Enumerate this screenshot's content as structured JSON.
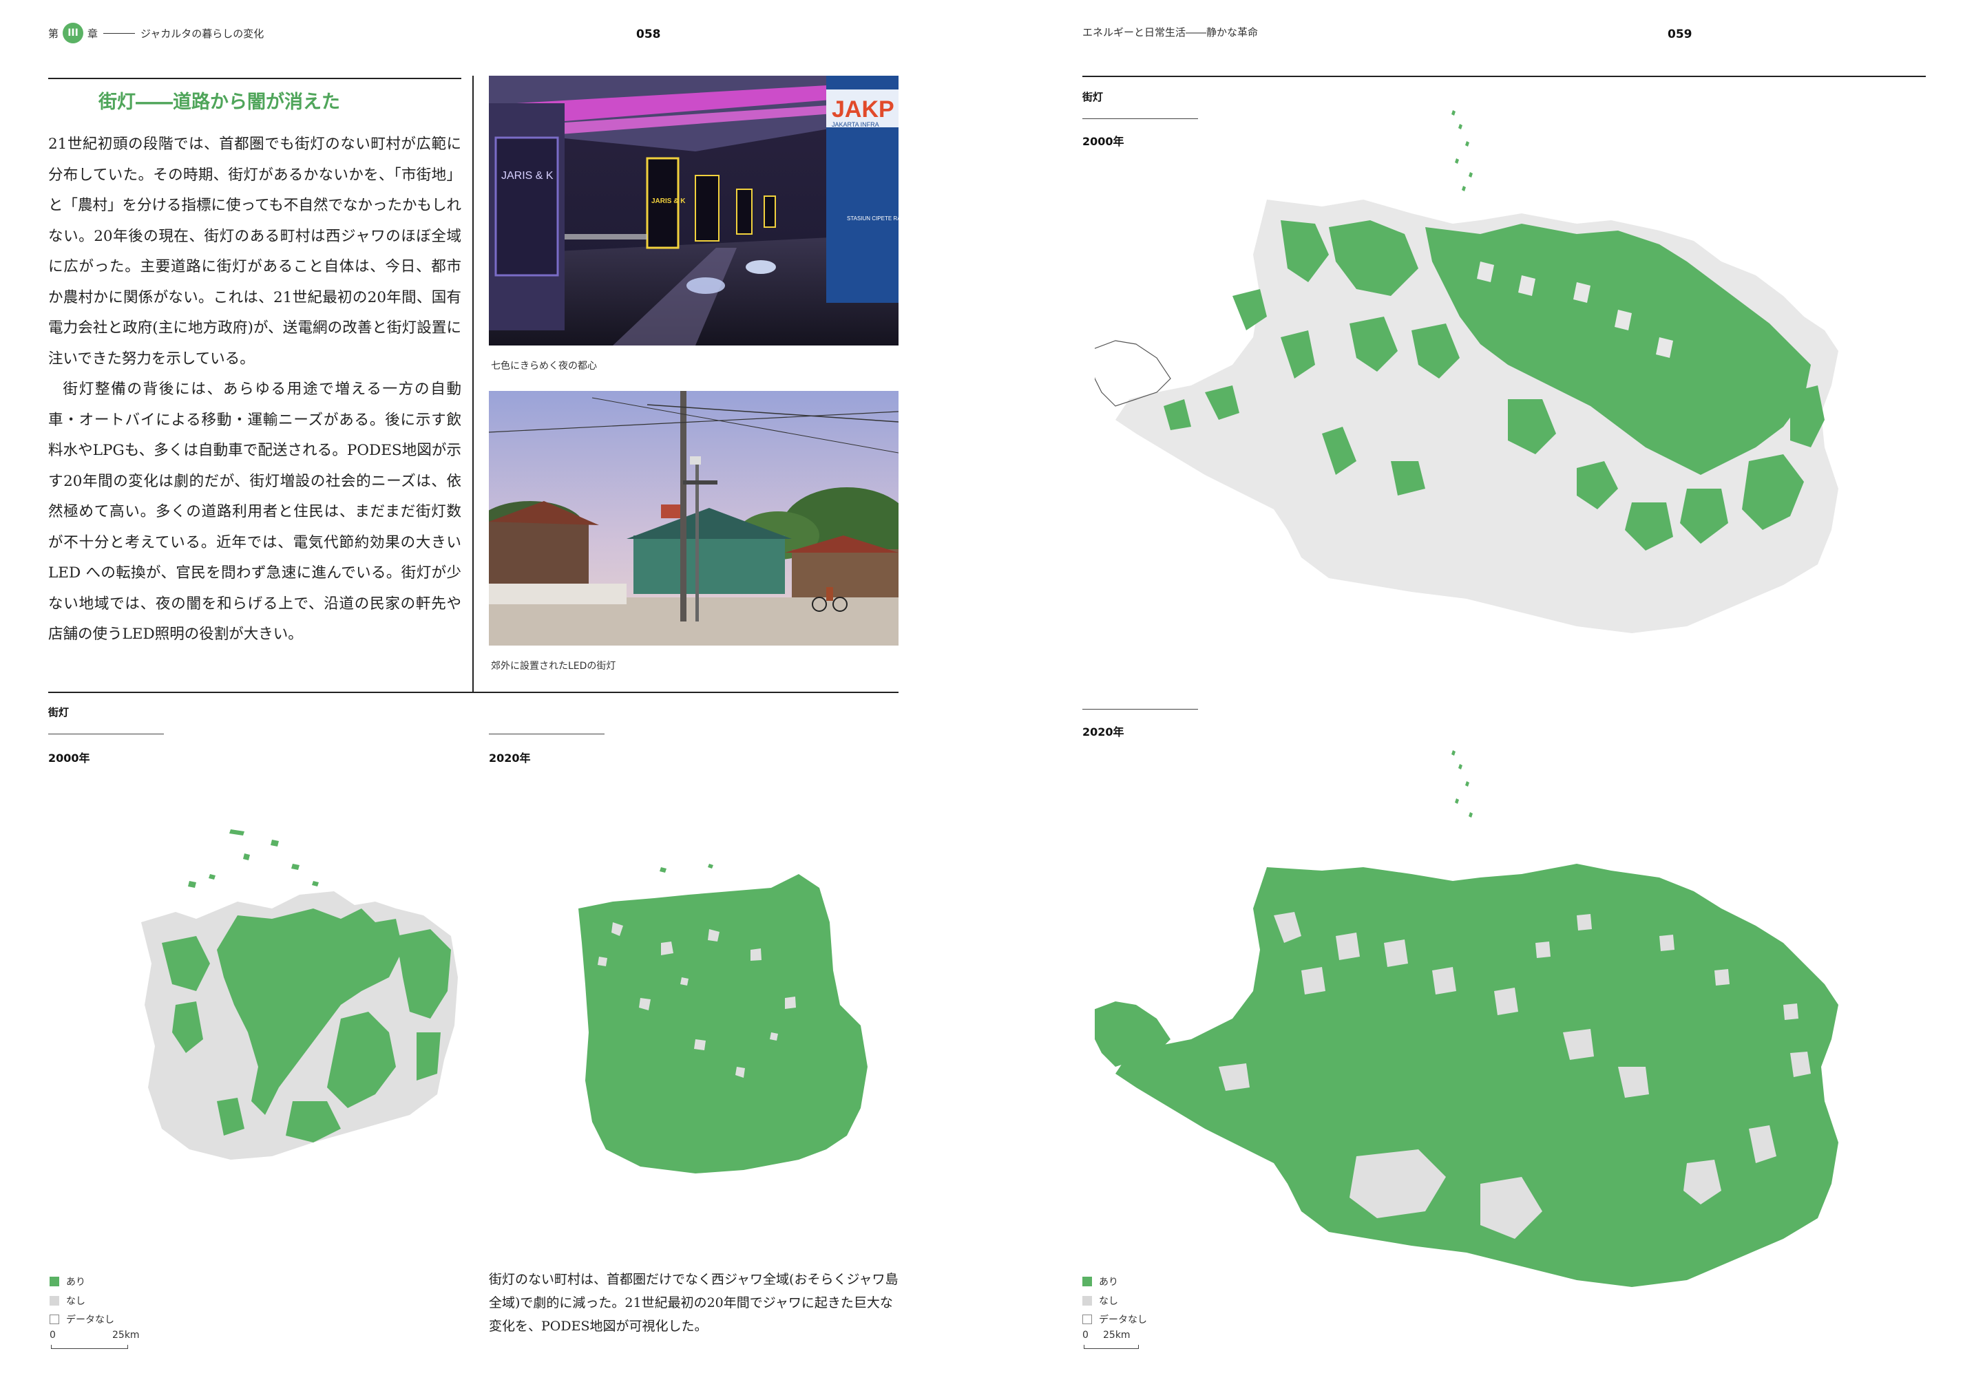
{
  "left_page": {
    "chapter_prefix": "第",
    "chapter_num": "III",
    "chapter_suffix": "章",
    "running_head": "ジャカルタの暮らしの変化",
    "page_number": "058"
  },
  "right_page": {
    "running_head": "エネルギーと日常生活――静かな革命",
    "page_number": "059"
  },
  "article": {
    "title": "街灯――道路から闇が消えた",
    "paragraph1": "21世紀初頭の段階では、首都圏でも街灯のない町村が広範に分布していた。その時期、街灯があるかないかを、「市街地」と「農村」を分ける指標に使っても不自然でなかったかもしれない。20年後の現在、街灯のある町村は西ジャワのほぼ全域に広がった。主要道路に街灯があること自体は、今日、都市か農村かに関係がない。これは、21世紀最初の20年間、国有電力会社と政府(主に地方政府)が、送電網の改善と街灯設置に注いできた努力を示している。",
    "paragraph2": "街灯整備の背後には、あらゆる用途で増える一方の自動車・オートバイによる移動・運輸ニーズがある。後に示す飲料水やLPGも、多くは自動車で配送される。PODES地図が示す20年間の変化は劇的だが、街灯増設の社会的ニーズは、依然極めて高い。多くの道路利用者と住民は、まだまだ街灯数が不十分と考えている。近年では、電気代節約効果の大きいLED への転換が、官民を問わず急速に進んでいる。街灯が少ない地域では、夜の闇を和らげる上で、沿道の民家の軒先や店舗の使うLED照明の役割が大きい。"
  },
  "photos": {
    "photo1_caption": "七色にきらめく夜の都心",
    "photo1_signs": [
      "JARIS & K",
      "JAKP",
      "JAKARTA INFRA",
      "STASIUN CIPETE RAYA"
    ],
    "photo2_caption": "郊外に設置されたLEDの街灯"
  },
  "maps": {
    "section_label": "街灯",
    "year_2000": "2000年",
    "year_2020": "2020年",
    "map_caption": "街灯のない町村は、首都圏だけでなく西ジャワ全域(おそらくジャワ島全域)で劇的に減った。21世紀最初の20年間でジャワに起きた巨大な変化を、PODES地図が可視化した。"
  },
  "legend": {
    "yes": "あり",
    "no": "なし",
    "no_data": "データなし",
    "scale_zero": "0",
    "scale_max": "25km"
  },
  "colors": {
    "yes": "#5ab264",
    "no": "#d7d7d7",
    "accent": "#4fa55a"
  }
}
